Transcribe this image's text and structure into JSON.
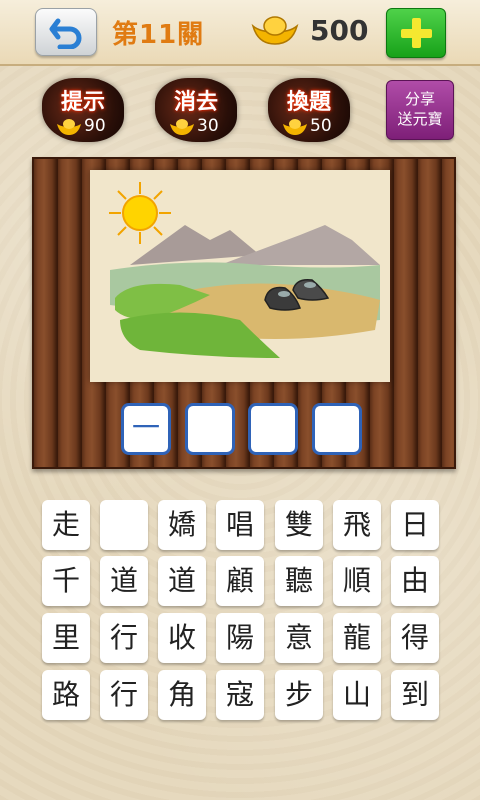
{
  "header": {
    "level_title": "第11關",
    "coins": "500"
  },
  "powerups": [
    {
      "label": "提示",
      "cost": "90"
    },
    {
      "label": "消去",
      "cost": "30"
    },
    {
      "label": "換題",
      "cost": "50"
    }
  ],
  "share": {
    "line1": "分享",
    "line2": "送元寶"
  },
  "answer": [
    "一",
    "",
    "",
    ""
  ],
  "grid": [
    [
      "走",
      "",
      "嬌",
      "唱",
      "雙",
      "飛",
      "日"
    ],
    [
      "千",
      "道",
      "道",
      "顧",
      "聽",
      "順",
      "由"
    ],
    [
      "里",
      "行",
      "收",
      "陽",
      "意",
      "龍",
      "得"
    ],
    [
      "路",
      "行",
      "角",
      "寇",
      "步",
      "山",
      "到"
    ]
  ],
  "colors": {
    "accent": "#e07b12",
    "slot_border": "#2f63b8",
    "add_button": "#17a219",
    "share_button": "#7e1f78"
  }
}
